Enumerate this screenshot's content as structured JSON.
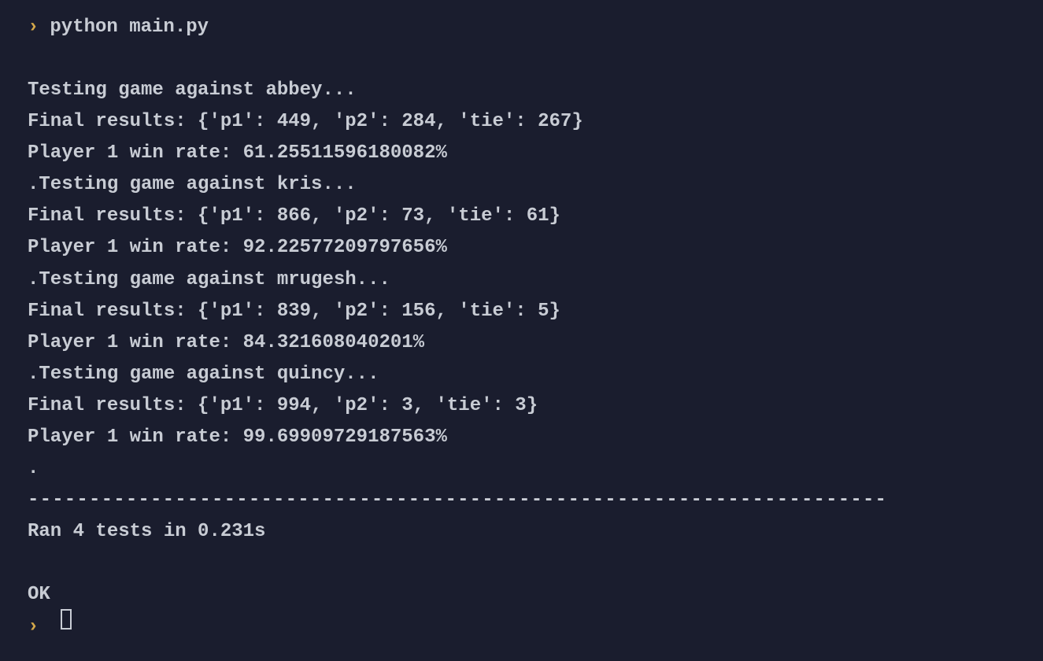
{
  "prompt": {
    "arrow": "›",
    "command": "python main.py"
  },
  "output": {
    "test1_header": "Testing game against abbey...",
    "test1_results": "Final results: {'p1': 449, 'p2': 284, 'tie': 267}",
    "test1_winrate": "Player 1 win rate: 61.25511596180082%",
    "test2_header": ".Testing game against kris...",
    "test2_results": "Final results: {'p1': 866, 'p2': 73, 'tie': 61}",
    "test2_winrate": "Player 1 win rate: 92.22577209797656%",
    "test3_header": ".Testing game against mrugesh...",
    "test3_results": "Final results: {'p1': 839, 'p2': 156, 'tie': 5}",
    "test3_winrate": "Player 1 win rate: 84.321608040201%",
    "test4_header": ".Testing game against quincy...",
    "test4_results": "Final results: {'p1': 994, 'p2': 3, 'tie': 3}",
    "test4_winrate": "Player 1 win rate: 99.69909729187563%",
    "dot": ".",
    "separator": "----------------------------------------------------------------------",
    "summary": "Ran 4 tests in 0.231s",
    "status": "OK"
  }
}
